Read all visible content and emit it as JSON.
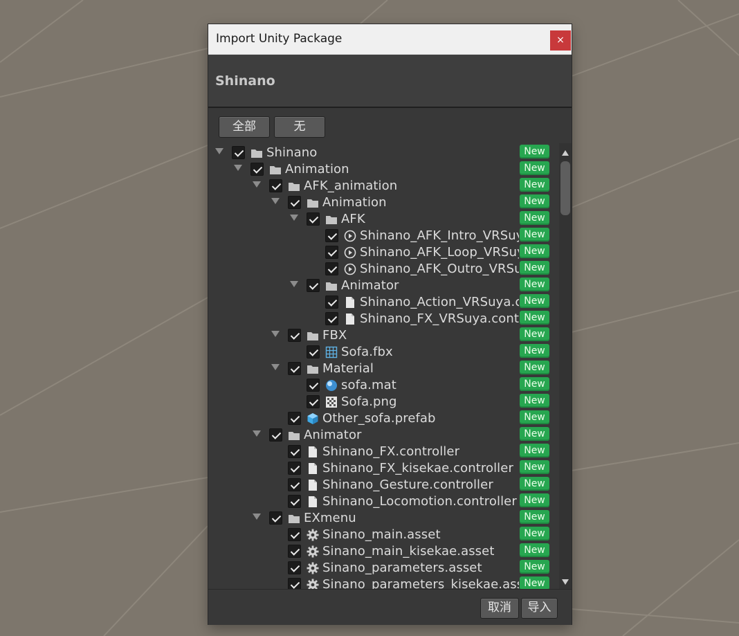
{
  "dialog": {
    "title": "Import Unity Package",
    "close_label": "×",
    "package_name": "Shinano"
  },
  "selection": {
    "all_label": "全部",
    "none_label": "无"
  },
  "badge_label": "New",
  "tree": [
    {
      "depth": 0,
      "expander": true,
      "icon": "folder-icon",
      "name": "Shinano"
    },
    {
      "depth": 1,
      "expander": true,
      "icon": "folder-icon",
      "name": "Animation"
    },
    {
      "depth": 2,
      "expander": true,
      "icon": "folder-icon",
      "name": "AFK_animation"
    },
    {
      "depth": 3,
      "expander": true,
      "icon": "folder-icon",
      "name": "Animation"
    },
    {
      "depth": 4,
      "expander": true,
      "icon": "folder-icon",
      "name": "AFK"
    },
    {
      "depth": 5,
      "expander": false,
      "icon": "anim-clip-icon",
      "name": "Shinano_AFK_Intro_VRSuya.anim"
    },
    {
      "depth": 5,
      "expander": false,
      "icon": "anim-clip-icon",
      "name": "Shinano_AFK_Loop_VRSuya.anim"
    },
    {
      "depth": 5,
      "expander": false,
      "icon": "anim-clip-icon",
      "name": "Shinano_AFK_Outro_VRSuya.anim"
    },
    {
      "depth": 4,
      "expander": true,
      "icon": "folder-icon",
      "name": "Animator"
    },
    {
      "depth": 5,
      "expander": false,
      "icon": "file-icon",
      "name": "Shinano_Action_VRSuya.controller"
    },
    {
      "depth": 5,
      "expander": false,
      "icon": "file-icon",
      "name": "Shinano_FX_VRSuya.controller"
    },
    {
      "depth": 3,
      "expander": true,
      "icon": "folder-icon",
      "name": "FBX"
    },
    {
      "depth": 4,
      "expander": false,
      "icon": "mesh-icon",
      "name": "Sofa.fbx"
    },
    {
      "depth": 3,
      "expander": true,
      "icon": "folder-icon",
      "name": "Material"
    },
    {
      "depth": 4,
      "expander": false,
      "icon": "material-icon",
      "name": "sofa.mat"
    },
    {
      "depth": 4,
      "expander": false,
      "icon": "texture-icon",
      "name": "Sofa.png"
    },
    {
      "depth": 3,
      "expander": false,
      "icon": "prefab-icon",
      "name": "Other_sofa.prefab"
    },
    {
      "depth": 2,
      "expander": true,
      "icon": "folder-icon",
      "name": "Animator"
    },
    {
      "depth": 3,
      "expander": false,
      "icon": "file-icon",
      "name": "Shinano_FX.controller"
    },
    {
      "depth": 3,
      "expander": false,
      "icon": "file-icon",
      "name": "Shinano_FX_kisekae.controller"
    },
    {
      "depth": 3,
      "expander": false,
      "icon": "file-icon",
      "name": "Shinano_Gesture.controller"
    },
    {
      "depth": 3,
      "expander": false,
      "icon": "file-icon",
      "name": "Shinano_Locomotion.controller"
    },
    {
      "depth": 2,
      "expander": true,
      "icon": "folder-icon",
      "name": "EXmenu"
    },
    {
      "depth": 3,
      "expander": false,
      "icon": "gear-icon",
      "name": "Sinano_main.asset"
    },
    {
      "depth": 3,
      "expander": false,
      "icon": "gear-icon",
      "name": "Sinano_main_kisekae.asset"
    },
    {
      "depth": 3,
      "expander": false,
      "icon": "gear-icon",
      "name": "Sinano_parameters.asset"
    },
    {
      "depth": 3,
      "expander": false,
      "icon": "gear-icon",
      "name": "Sinano_parameters_kisekae.asset"
    }
  ],
  "footer": {
    "cancel_label": "取消",
    "import_label": "导入"
  }
}
